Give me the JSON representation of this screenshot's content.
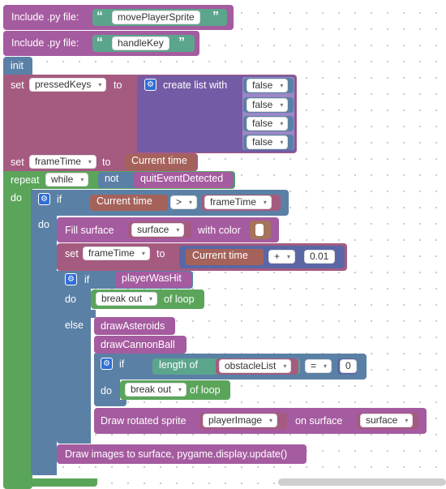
{
  "colors": {
    "procedure": "#a55b9f",
    "variable": "#a55b80",
    "list": "#745ba5",
    "logic": "#5b80a5",
    "loop": "#5ba55b",
    "math": "#5b67a5",
    "text": "#5ba58c",
    "time": "#a5625b"
  },
  "include1": {
    "label": "Include .py file:",
    "value": "movePlayerSprite"
  },
  "include2": {
    "label": "Include .py file:",
    "value": "handleKey"
  },
  "init": {
    "label": "init"
  },
  "set_pressed": {
    "set_label": "set",
    "var": "pressedKeys",
    "to_label": "to",
    "create_list_label": "create list with",
    "items": [
      "false",
      "false",
      "false",
      "false"
    ]
  },
  "set_frame": {
    "set_label": "set",
    "var": "frameTime",
    "to_label": "to",
    "value": "Current time"
  },
  "repeat": {
    "label": "repeat",
    "mode": "while",
    "not_label": "not",
    "condition": "quitEventDetected",
    "do_label": "do"
  },
  "if_time": {
    "if_label": "if",
    "left": "Current time",
    "op": ">",
    "right": "frameTime",
    "do_label": "do"
  },
  "fill": {
    "label": "Fill surface",
    "surface": "surface",
    "with_color_label": "with color"
  },
  "set_frame2": {
    "set_label": "set",
    "var": "frameTime",
    "to_label": "to",
    "left": "Current time",
    "op": "+",
    "number": "0.01"
  },
  "if_hit": {
    "if_label": "if",
    "condition": "playerWasHit",
    "do_label": "do",
    "break_label": "break out",
    "of_loop_label": "of loop",
    "else_label": "else"
  },
  "draw_asteroids": {
    "label": "drawAsteroids"
  },
  "draw_cannon": {
    "label": "drawCannonBall"
  },
  "if_len": {
    "if_label": "if",
    "length_label": "length of",
    "list": "obstacleList",
    "op": "=",
    "number": "0",
    "do_label": "do",
    "break_label": "break out",
    "of_loop_label": "of loop"
  },
  "draw_rotated": {
    "label": "Draw rotated sprite",
    "sprite": "playerImage",
    "on_surface_label": "on surface",
    "surface": "surface"
  },
  "draw_images": {
    "label": "Draw images to surface, pygame.display.update()"
  }
}
